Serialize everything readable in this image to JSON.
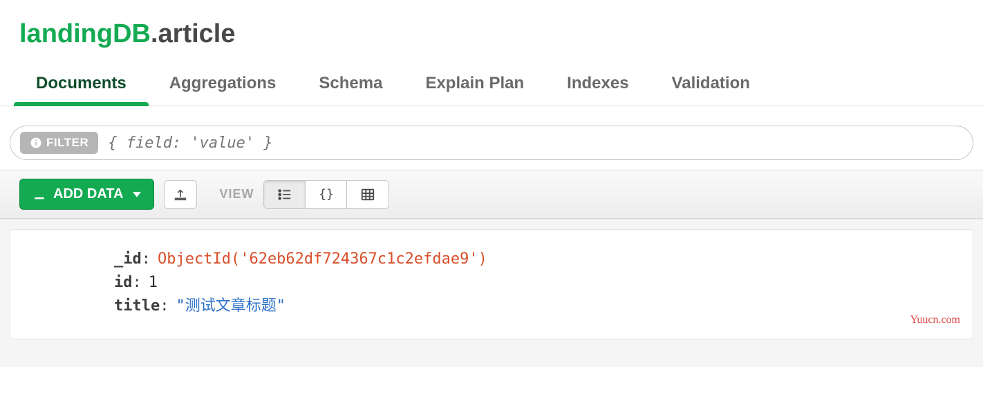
{
  "namespace": {
    "db": "landingDB",
    "collection": ".article"
  },
  "tabs": [
    "Documents",
    "Aggregations",
    "Schema",
    "Explain Plan",
    "Indexes",
    "Validation"
  ],
  "active_tab": 0,
  "filter": {
    "label": "FILTER",
    "placeholder": "{ field: 'value' }"
  },
  "toolbar": {
    "add_data": "ADD DATA",
    "view_label": "VIEW"
  },
  "document": {
    "fields": [
      {
        "key": "_id",
        "value": "ObjectId('62eb62df724367c1c2efdae9')",
        "type": "oid"
      },
      {
        "key": "id",
        "value": "1",
        "type": "num"
      },
      {
        "key": "title",
        "value": "\"测试文章标题\"",
        "type": "str"
      }
    ]
  },
  "watermark": "Yuucn.com"
}
